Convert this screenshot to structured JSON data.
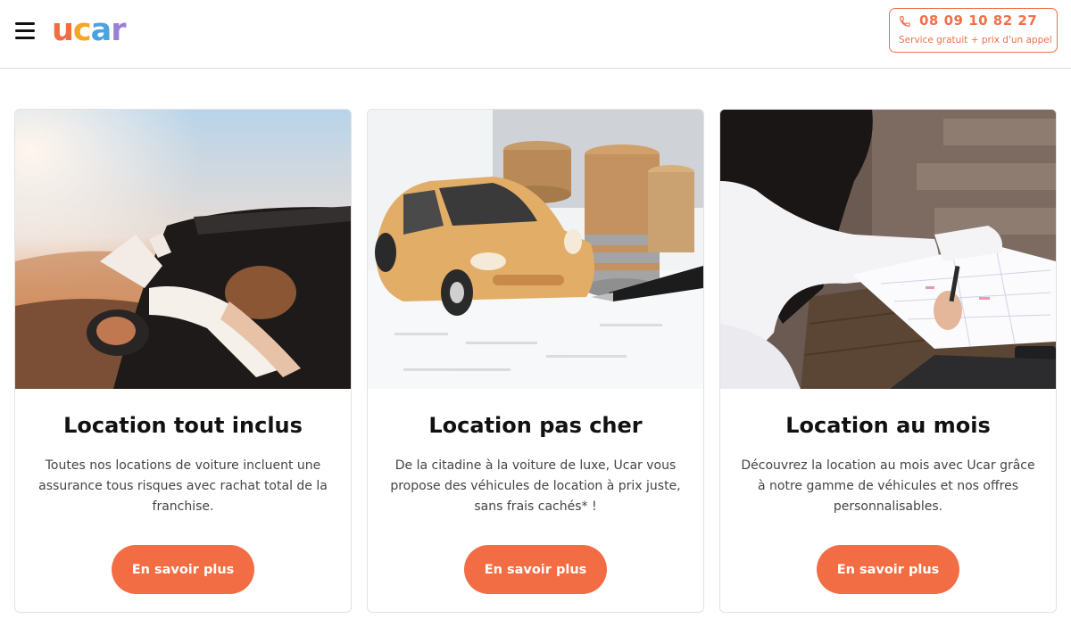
{
  "header": {
    "logo": {
      "letters": [
        "u",
        "c",
        "a",
        "r"
      ],
      "colors": [
        "#f26d43",
        "#f5a623",
        "#4aa3df",
        "#9b7fd4"
      ]
    },
    "phone": {
      "number": "08 09 10 82 27",
      "subtitle": "Service gratuit + prix d'un appel",
      "icon": "phone-icon"
    },
    "menu_icon": "hamburger-icon"
  },
  "colors": {
    "accent": "#f26d43"
  },
  "cards": [
    {
      "title": "Location tout inclus",
      "text": "Toutes nos locations de voiture incluent une assurance tous risques avec rachat total de la franchise.",
      "button": "En savoir plus",
      "image": "convertible-car-photo"
    },
    {
      "title": "Location pas cher",
      "text": "De la citadine à la voiture de luxe, Ucar vous propose des véhicules de location à prix juste, sans frais cachés* !",
      "button": "En savoir plus",
      "image": "toy-car-coins-photo"
    },
    {
      "title": "Location au mois",
      "text": "Découvrez la location au mois avec Ucar grâce à notre gamme de véhicules et nos offres personnalisables.",
      "button": "En savoir plus",
      "image": "woman-calendar-photo"
    }
  ]
}
